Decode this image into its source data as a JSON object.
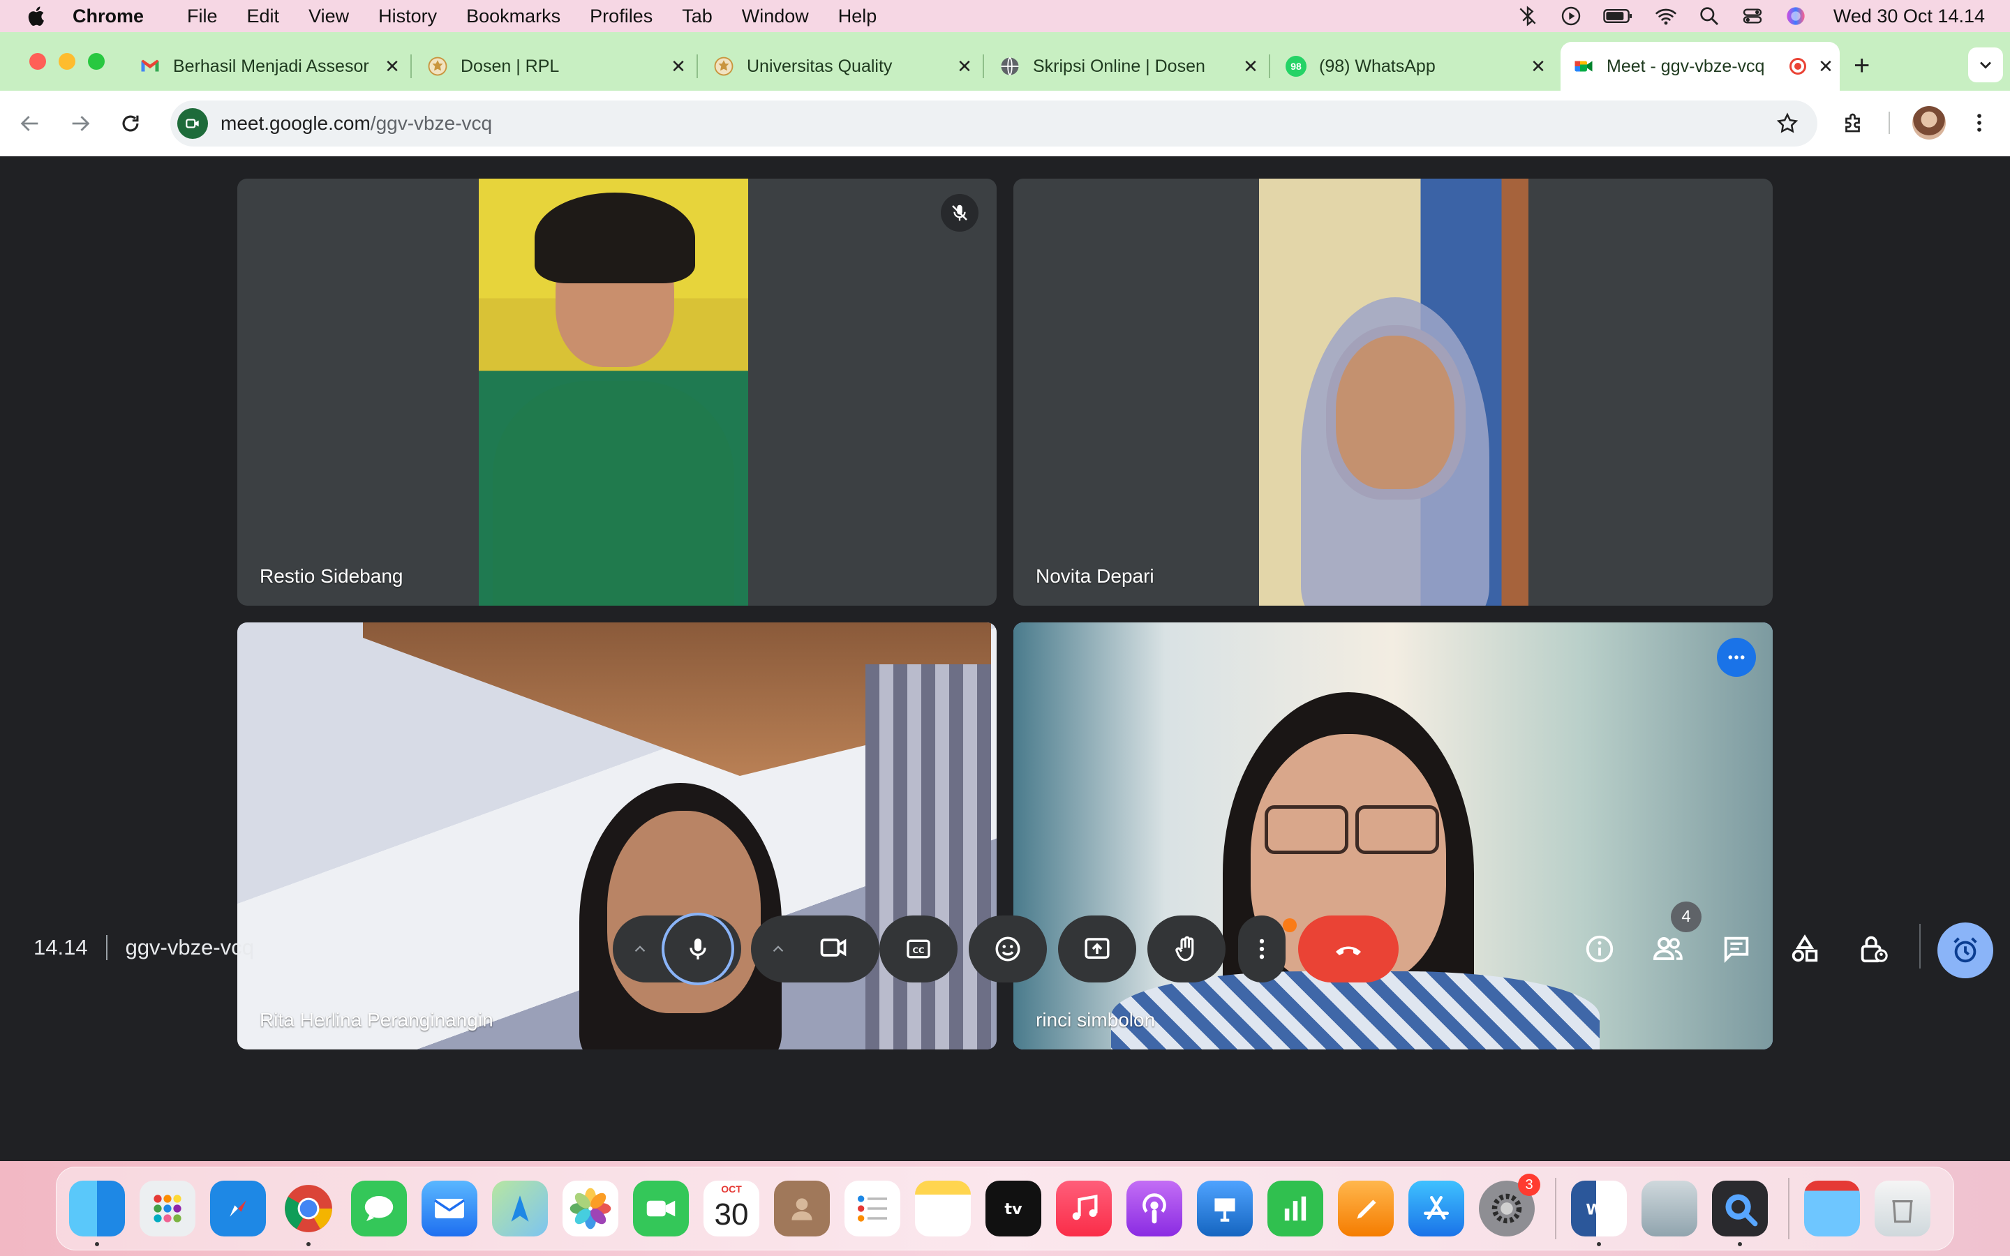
{
  "menubar": {
    "app_name": "Chrome",
    "menus": [
      "File",
      "Edit",
      "View",
      "History",
      "Bookmarks",
      "Profiles",
      "Tab",
      "Window",
      "Help"
    ],
    "clock": "Wed 30 Oct  14.14"
  },
  "tabs": [
    {
      "title": "Berhasil Menjadi Assesor",
      "favicon": "gmail-icon",
      "color": "#ea4335"
    },
    {
      "title": "Dosen | RPL",
      "favicon": "university-icon",
      "color": "#d9a441"
    },
    {
      "title": "Universitas Quality",
      "favicon": "university-icon",
      "color": "#d9a441"
    },
    {
      "title": "Skripsi Online | Dosen",
      "favicon": "globe-icon",
      "color": "#5f6368"
    },
    {
      "title": "(98) WhatsApp",
      "favicon": "whatsapp-icon",
      "color": "#25d366",
      "badge": "98"
    },
    {
      "title": "Meet - ggv-vbze-vcq",
      "favicon": "meet-icon",
      "color": "#00897b",
      "active": true,
      "recording": true
    }
  ],
  "address_bar": {
    "host": "meet.google.com",
    "path": "/ggv-vbze-vcq"
  },
  "participants": [
    {
      "name": "Restio Sidebang",
      "muted": true
    },
    {
      "name": "Novita Depari",
      "muted": false
    },
    {
      "name": "Rita Herlina Peranginangin",
      "muted": false
    },
    {
      "name": "rinci simbolon",
      "muted": false,
      "active_speaker": true
    }
  ],
  "meeting": {
    "time": "14.14",
    "code": "ggv-vbze-vcq",
    "participant_count": "4"
  },
  "dock": {
    "calendar_month": "OCT",
    "calendar_day": "30",
    "settings_badge": "3"
  },
  "colors": {
    "accent": "#8ab4f8",
    "hangup": "#ea4335",
    "meet_bg": "#202124"
  }
}
